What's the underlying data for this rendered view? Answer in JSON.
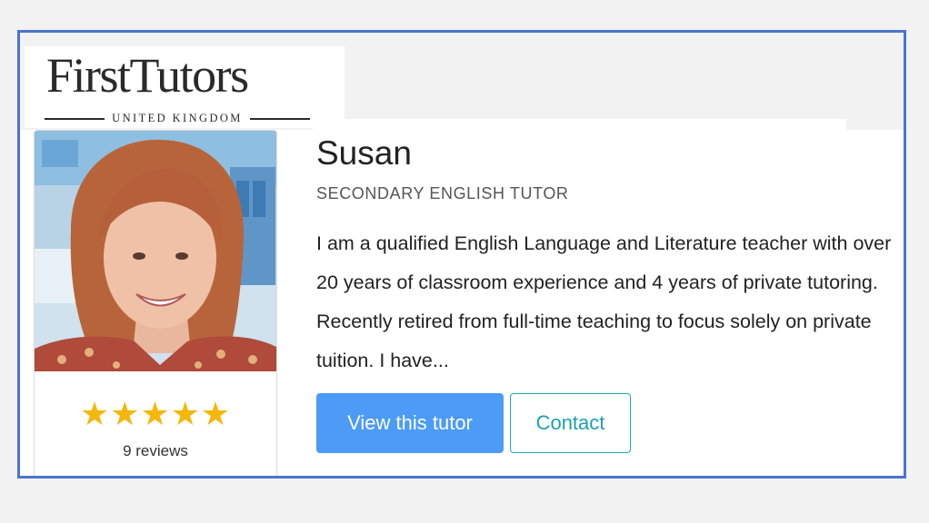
{
  "brand": {
    "name": "FirstTutors",
    "tagline": "UNITED KINGDOM"
  },
  "tutor": {
    "name": "Susan",
    "subject": "SECONDARY ENGLISH TUTOR",
    "bio": "I am a qualified English Language and Literature teacher with over 20 years of classroom experience and 4 years of private tutoring. Recently retired from full-time teaching to focus solely on private tuition. I have...",
    "rating": 5,
    "rating_max": 5,
    "stars": "★★★★★",
    "reviews_label": "9 reviews"
  },
  "actions": {
    "view_label": "View this tutor",
    "contact_label": "Contact"
  },
  "colors": {
    "frame_border": "#4a74d0",
    "star": "#f4b70c",
    "primary_button": "#4c9bf6",
    "contact_accent": "#1aa1b0"
  },
  "icons": {
    "rating": "star-icon",
    "photo": "tutor-photo"
  }
}
